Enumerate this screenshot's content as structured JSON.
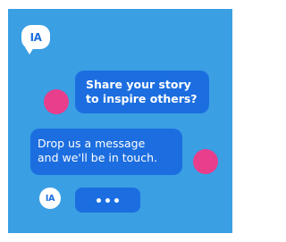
{
  "logo": {
    "text": "IA"
  },
  "messages": [
    {
      "lines": [
        "Share your story",
        "to inspire others?"
      ]
    },
    {
      "lines": [
        "Drop us a message",
        "and we'll be in touch."
      ]
    }
  ],
  "avatar": {
    "text": "IA"
  },
  "typing_indicator": {
    "dots": 3
  },
  "colors": {
    "background": "#3a9fe3",
    "bubble": "#1c6ee0",
    "accent_dot": "#e83e8c",
    "text": "#ffffff"
  }
}
